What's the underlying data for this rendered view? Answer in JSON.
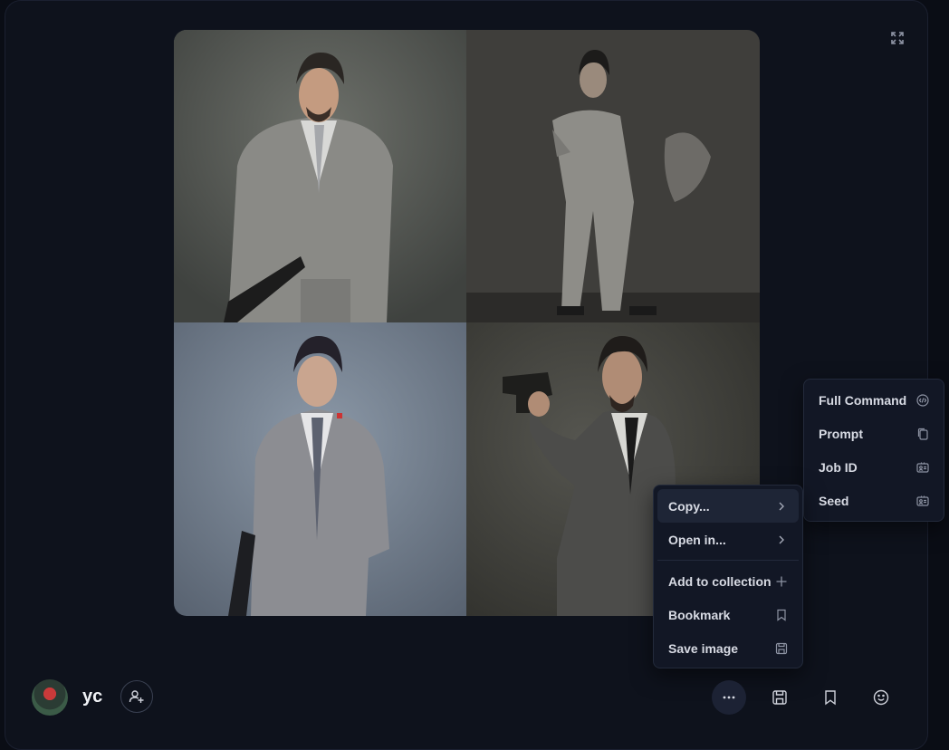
{
  "image_grid": {
    "tiles": [
      {
        "name": "image-tile-1"
      },
      {
        "name": "image-tile-2"
      },
      {
        "name": "image-tile-3"
      },
      {
        "name": "image-tile-4"
      }
    ]
  },
  "actions_menu": {
    "items": [
      {
        "label": "Copy...",
        "icon": "chevron-right-icon"
      },
      {
        "label": "Open in...",
        "icon": "chevron-right-icon"
      },
      {
        "label": "Add to collection",
        "icon": "plus-icon"
      },
      {
        "label": "Bookmark",
        "icon": "bookmark-icon"
      },
      {
        "label": "Save image",
        "icon": "save-icon"
      }
    ]
  },
  "copy_submenu": {
    "items": [
      {
        "label": "Full Command",
        "icon": "code-icon"
      },
      {
        "label": "Prompt",
        "icon": "copy-icon"
      },
      {
        "label": "Job ID",
        "icon": "id-card-icon"
      },
      {
        "label": "Seed",
        "icon": "id-card-icon"
      }
    ]
  },
  "user": {
    "name": "yc"
  },
  "toolbar": {
    "buttons": [
      "more-icon",
      "save-icon",
      "bookmark-icon",
      "emoji-icon"
    ]
  },
  "colors": {
    "background": "#0a0d15",
    "panel": "#0e121c",
    "menu": "#121725",
    "menu_active": "#1e2536"
  }
}
